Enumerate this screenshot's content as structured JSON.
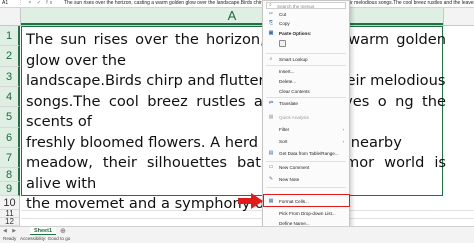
{
  "formula_bar": {
    "name_box": "A1",
    "buttons": "⋮ × ✓ fx",
    "content": "The sun rises over the horizon, casting a warm golden glow over the landscape.Birds chirp and flutter about, filling the air with their melodious songs.The cool breez rustles and the leaves of"
  },
  "column_header": {
    "col_a": "A"
  },
  "rows": [
    "1",
    "2",
    "3",
    "4",
    "5",
    "6",
    "7",
    "8",
    "9",
    "10",
    "11",
    "12"
  ],
  "cell_text": "The sun rises over the horizon, casting a warm golden glow over the\nlandscape.Birds chirp and flutter about, filli       eir melodious\nsongs.The cool breez rustles and the leaves o        ng the scents of\nfreshly bloomed flowers. A herd of deer               in a nearby\nmeadow, their silhouettes bathed early mor            world is alive with\nthe movemet and a symphony of natu",
  "context_menu": {
    "search_placeholder": "Search the menus",
    "items": [
      {
        "label": "Cut",
        "icon": "✂"
      },
      {
        "label": "Copy",
        "icon": "⎘"
      },
      {
        "label": "Paste Options:",
        "icon": "📋"
      },
      {
        "label": "Smart Lookup",
        "icon": "🔍"
      },
      {
        "label": "Insert...",
        "icon": ""
      },
      {
        "label": "Delete...",
        "icon": ""
      },
      {
        "label": "Clear Contents",
        "icon": ""
      },
      {
        "label": "Translate",
        "icon": "⇄"
      },
      {
        "label": "Quick Analysis",
        "icon": "▦"
      },
      {
        "label": "Filter",
        "icon": ""
      },
      {
        "label": "Sort",
        "icon": ""
      },
      {
        "label": "Get Data from Table/Range...",
        "icon": "▤"
      },
      {
        "label": "New Comment",
        "icon": "💬"
      },
      {
        "label": "New Note",
        "icon": "✎"
      },
      {
        "label": "Format Cells...",
        "icon": "▦"
      },
      {
        "label": "Pick From Drop-down List...",
        "icon": ""
      },
      {
        "label": "Define Name...",
        "icon": ""
      },
      {
        "label": "Link",
        "icon": "🔗"
      }
    ],
    "submenu_arrow": "›"
  },
  "sheet_tabs": {
    "nav": "◀ ▶",
    "active": "Sheet1",
    "add": "⊕"
  },
  "status_bar": {
    "ready": "Ready",
    "accessibility": "Accessibility: Good to go"
  },
  "accent_color": "#217346",
  "highlight_color": "#e11b1b"
}
